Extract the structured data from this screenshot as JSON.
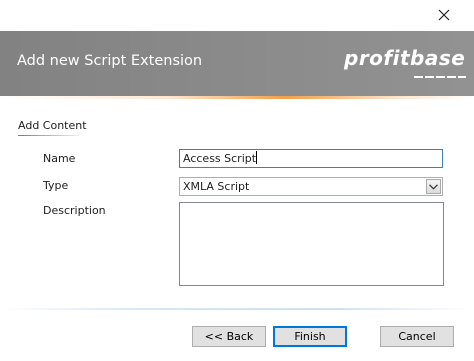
{
  "dialog": {
    "header_title": "Add new Script Extension",
    "logo_text": "profitbase"
  },
  "content": {
    "section_title": "Add Content",
    "name": {
      "label": "Name",
      "value": "Access Script"
    },
    "type": {
      "label": "Type",
      "selected": "XMLA Script"
    },
    "description": {
      "label": "Description",
      "value": ""
    }
  },
  "buttons": {
    "back": "<< Back",
    "finish": "Finish",
    "cancel": "Cancel"
  },
  "colors": {
    "banner": "#8a8a8a",
    "accent_orange": "#f2a04a",
    "focus_border": "#3c7fb1",
    "default_button_border": "#0078d7"
  }
}
